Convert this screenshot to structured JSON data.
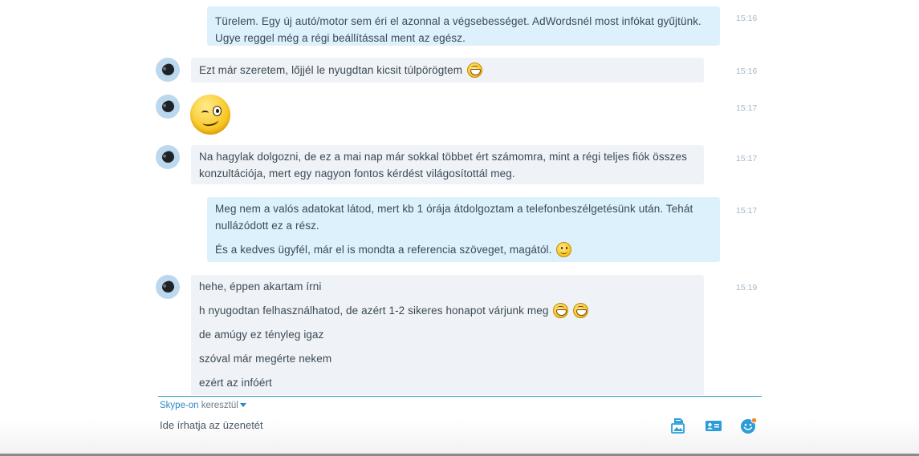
{
  "messages": [
    {
      "id": "m1",
      "direction": "out",
      "time": "15:16",
      "paragraphs": [
        {
          "text": "Türelem. Egy új autó/motor sem éri el azonnal a végsebességet. AdWordsnél most infókat gyűjtünk. Ugye reggel még a régi beállítással ment az egész."
        }
      ]
    },
    {
      "id": "m2",
      "direction": "in",
      "time": "15:16",
      "paragraphs": [
        {
          "text": "Ezt már szeretem, lőjjél le nyugdtan kicsit túlpörögtem",
          "emoticons": [
            "grin-emoticon"
          ]
        }
      ]
    },
    {
      "id": "m3",
      "direction": "in",
      "time": "15:17",
      "emoticon": "wink-emoticon"
    },
    {
      "id": "m4",
      "direction": "in",
      "time": "15:17",
      "paragraphs": [
        {
          "text": "Na hagylak dolgozni, de ez a mai nap már sokkal többet ért számomra, mint a régi teljes fiók összes konzultációja, mert egy nagyon fontos kérdést világosítottál meg."
        }
      ]
    },
    {
      "id": "m5",
      "direction": "out",
      "time": "15:17",
      "paragraphs": [
        {
          "text": "Meg nem a valós adatokat látod, mert kb 1 órája átdolgoztam a telefonbeszélgetésünk után. Tehát nullázódott ez a rész."
        },
        {
          "text": "És a kedves ügyfél, már el is mondta a referencia szöveget, magától.",
          "emoticons": [
            "smile-emoticon"
          ]
        }
      ]
    },
    {
      "id": "m6",
      "direction": "in",
      "time": "15:19",
      "paragraphs": [
        {
          "text": "hehe, éppen akartam írni"
        },
        {
          "text": "h nyugodtan felhasználhatod, de azért 1-2 sikeres honapot várjunk meg",
          "emoticons": [
            "grin-emoticon",
            "grin-emoticon"
          ]
        },
        {
          "text": "de amúgy ez tényleg igaz"
        },
        {
          "text": "szóval már megérte nekem"
        },
        {
          "text": "ezért az infóért"
        }
      ]
    }
  ],
  "composer": {
    "via_link": "Skype-on",
    "via_text": " keresztül",
    "placeholder": "Ide írhatja az üzenetét",
    "tools": [
      {
        "name": "send-media-icon"
      },
      {
        "name": "send-contact-icon"
      },
      {
        "name": "emoticon-picker-icon"
      }
    ]
  },
  "colors": {
    "accent": "#2b9dd8",
    "incoming_bubble": "#eff2f6",
    "outgoing_bubble": "#dcf1fc",
    "timestamp": "#a7b6c2"
  }
}
